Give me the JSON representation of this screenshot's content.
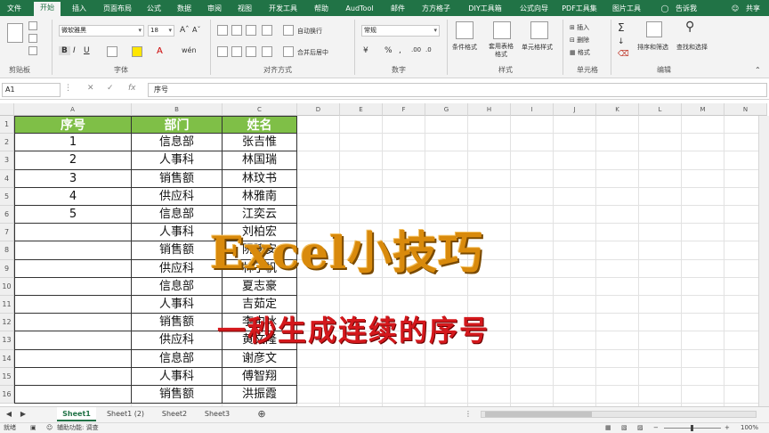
{
  "ribbon_tabs": [
    "文件",
    "开始",
    "插入",
    "页面布局",
    "公式",
    "数据",
    "审阅",
    "视图",
    "开发工具",
    "帮助",
    "AudTool",
    "邮件",
    "方方格子",
    "DIY工具箱",
    "公式向导",
    "PDF工具集",
    "图片工具"
  ],
  "tell_me": "告诉我",
  "share": "共享",
  "ribbon": {
    "font_name": "微软雅黑",
    "font_size": "18",
    "number_format": "常规",
    "wrap_text": "自动换行",
    "merge_center": "合并后居中",
    "cond_format": "条件格式",
    "table_format": "套用表格格式",
    "cell_style": "单元格样式",
    "insert": "插入",
    "delete": "删除",
    "format": "格式",
    "sort_filter": "排序和筛选",
    "find_select": "查找和选择",
    "groups": [
      "剪贴板",
      "字体",
      "对齐方式",
      "数字",
      "样式",
      "单元格",
      "编辑"
    ]
  },
  "formula_bar": {
    "name_box": "A1",
    "fx": "fx",
    "content": "序号"
  },
  "columns": [
    "A",
    "B",
    "C",
    "D",
    "E",
    "F",
    "G",
    "H",
    "I",
    "J",
    "K",
    "L",
    "M",
    "N"
  ],
  "rows": [
    "1",
    "2",
    "3",
    "4",
    "5",
    "6",
    "7",
    "8",
    "9",
    "10",
    "11",
    "12",
    "13",
    "14",
    "15",
    "16"
  ],
  "table": {
    "headers": [
      "序号",
      "部门",
      "姓名"
    ],
    "rows": [
      [
        "1",
        "信息部",
        "张吉惟"
      ],
      [
        "2",
        "人事科",
        "林国瑞"
      ],
      [
        "3",
        "销售额",
        "林玟书"
      ],
      [
        "4",
        "供应科",
        "林雅南"
      ],
      [
        "5",
        "信息部",
        "江奕云"
      ],
      [
        "",
        "人事科",
        "刘柏宏"
      ],
      [
        "",
        "销售额",
        "阮建安"
      ],
      [
        "",
        "供应科",
        "林子帆"
      ],
      [
        "",
        "信息部",
        "夏志豪"
      ],
      [
        "",
        "人事科",
        "吉茹定"
      ],
      [
        "",
        "销售额",
        "李中冰"
      ],
      [
        "",
        "供应科",
        "黄文隆"
      ],
      [
        "",
        "信息部",
        "谢彦文"
      ],
      [
        "",
        "人事科",
        "傅智翔"
      ],
      [
        "",
        "销售额",
        "洪振霞"
      ]
    ]
  },
  "overlay": {
    "title": "Excel小技巧",
    "subtitle": "一秒生成连续的序号"
  },
  "sheets": [
    "Sheet1",
    "Sheet1 (2)",
    "Sheet2",
    "Sheet3"
  ],
  "status": {
    "ready": "就绪",
    "accessibility": "辅助功能: 调查",
    "zoom": "100%"
  },
  "colors": {
    "excel_green": "#217346",
    "header_fill": "#7fbf47",
    "title_orange": "#d98a0c",
    "subtitle_red": "#d4181c"
  }
}
